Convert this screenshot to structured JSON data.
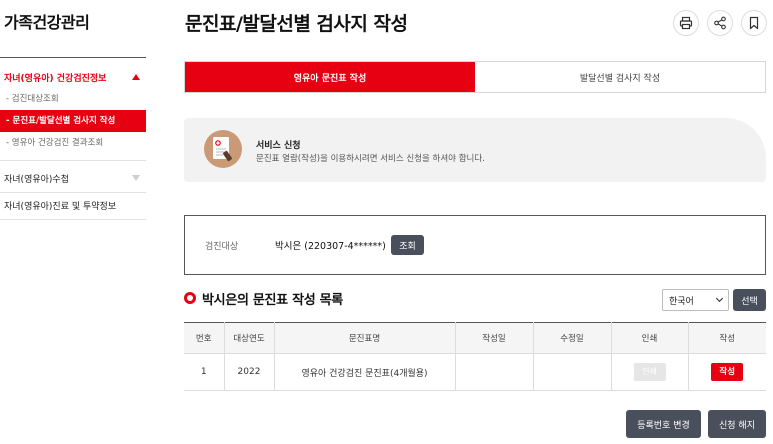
{
  "sidebar": {
    "title": "가족건강관리",
    "groups": [
      {
        "label": "자녀(영유아) 건강검진정보",
        "items": [
          "검진대상조회",
          "문진표/발달선별 검사지 작성",
          "영유아 건강검진 결과조회"
        ]
      },
      {
        "label": "자녀(영유아)수첩"
      },
      {
        "label": "자녀(영유아)진료 및 투약정보"
      }
    ]
  },
  "header": {
    "title": "문진표/발달선별 검사지 작성",
    "actions": [
      "print-icon",
      "share-icon",
      "bookmark-icon"
    ]
  },
  "tabs": [
    "영유아 문진표 작성",
    "발달선별 검사지 작성"
  ],
  "notice": {
    "title": "서비스 신청",
    "text": "문진표 열람(작성)을 이용하시려면 서비스 신청을 하셔야 합니다."
  },
  "target": {
    "label": "검진대상",
    "value": "박시은 (220307-4******)",
    "button": "조회"
  },
  "list": {
    "title": "박시은의 문진표 작성 목록",
    "language": "한국어",
    "select_button": "선택",
    "columns": [
      "번호",
      "대상연도",
      "문진표명",
      "작성일",
      "수정일",
      "인쇄",
      "작성"
    ],
    "rows": [
      {
        "no": "1",
        "year": "2022",
        "name": "영유아 건강검진 문진표(4개월용)",
        "created": "",
        "modified": "",
        "print": "인쇄",
        "write": "작성"
      }
    ]
  },
  "footer": {
    "change_button": "등록번호 변경",
    "cancel_button": "신청 해지"
  },
  "colors": {
    "accent": "#e60012",
    "dark_button": "#4a4f5c",
    "notice_bg": "#f2f2f2"
  }
}
